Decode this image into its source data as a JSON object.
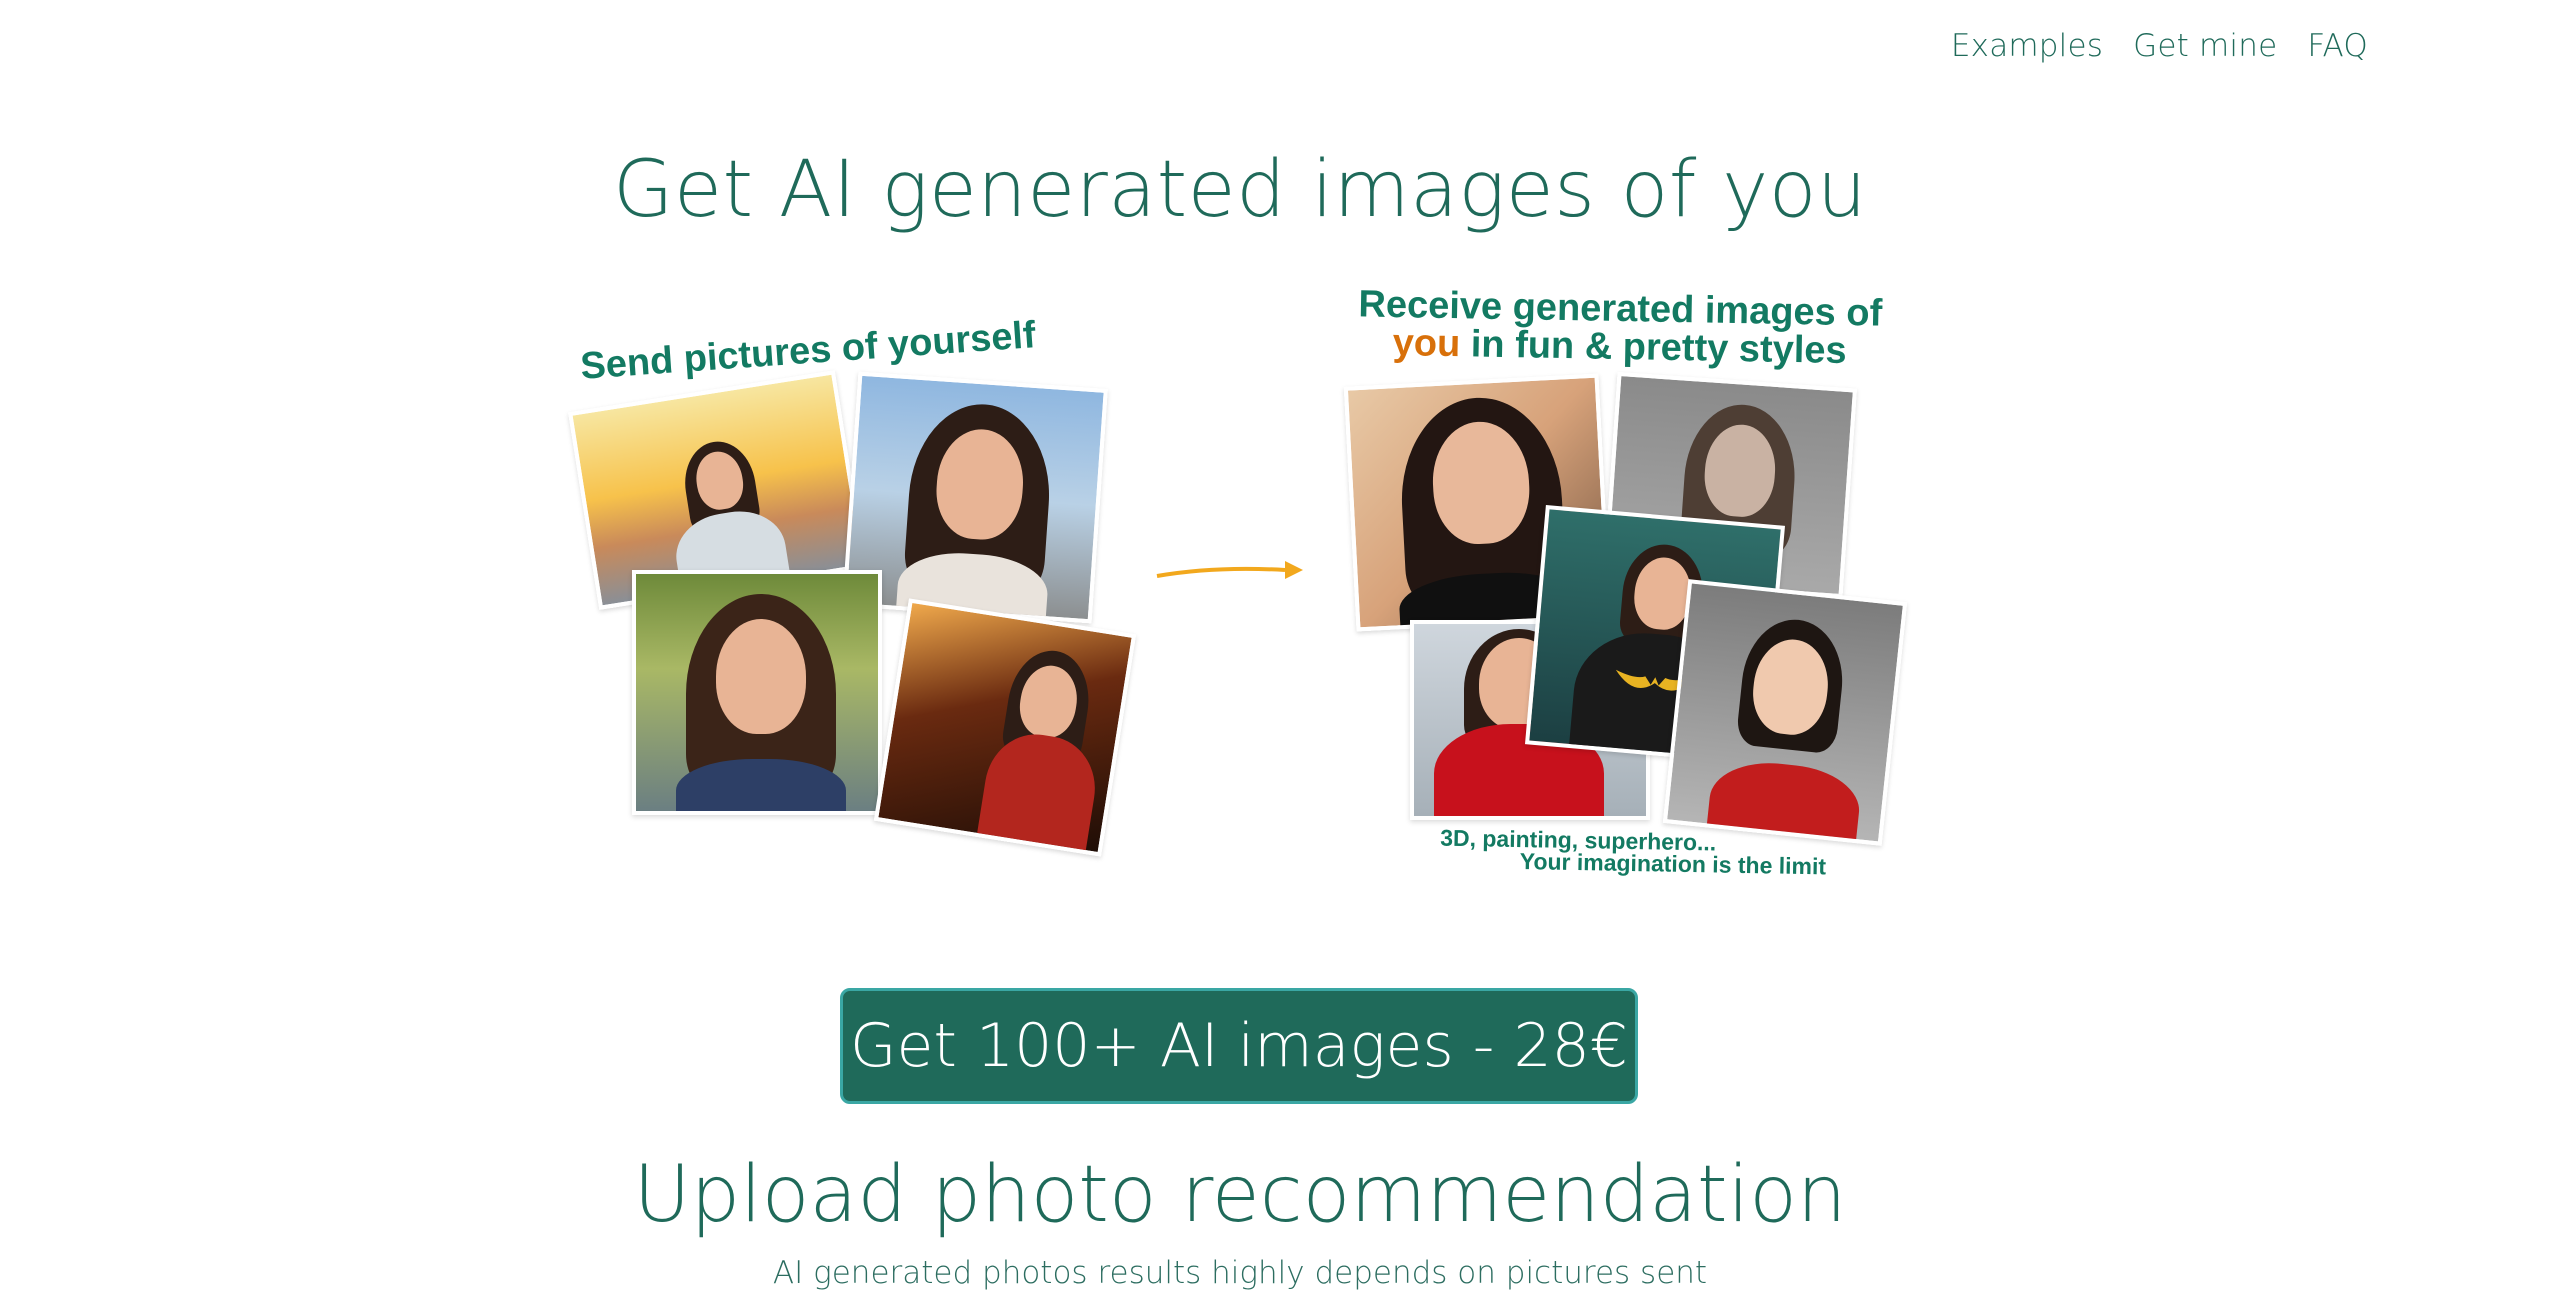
{
  "nav": {
    "links": [
      "Examples",
      "Get mine",
      "FAQ"
    ]
  },
  "hero": {
    "title": "Get AI generated images of you"
  },
  "illustration": {
    "send_caption": "Send pictures of yourself",
    "receive_caption_line1": "Receive generated images of",
    "receive_caption_you": "you",
    "receive_caption_line2_rest": " in fun & pretty styles",
    "styles_line1": "3D, painting, superhero...",
    "styles_line2": "Your imagination is the limit"
  },
  "cta": {
    "label": "Get 100+ AI images - 28€"
  },
  "upload": {
    "title": "Upload photo recommendation",
    "subtitle": "AI generated photos results highly depends on pictures sent"
  },
  "colors": {
    "brand_green": "#1f6a5a",
    "caption_green": "#137a62",
    "accent_orange": "#d8700a",
    "arrow": "#f2a81d"
  }
}
